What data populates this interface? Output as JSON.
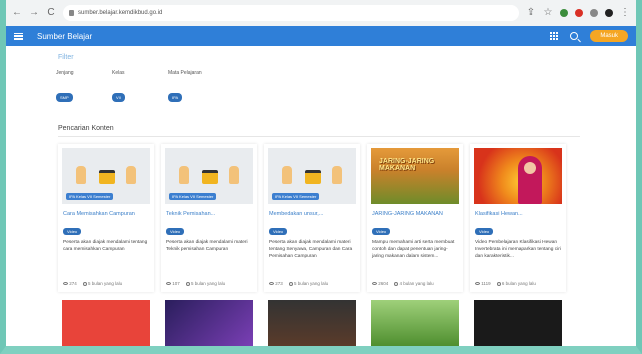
{
  "browser": {
    "url": "sumber.belajar.kemdikbud.go.id",
    "nav": [
      "←",
      "→",
      "C"
    ]
  },
  "header": {
    "title": "Sumber Belajar",
    "login_label": "Masuk",
    "colors": {
      "bar": "#2f7fd8",
      "login": "#f5a623"
    }
  },
  "filter": {
    "title": "Filter",
    "groups": [
      {
        "label": "Jenjang",
        "value": "SMP"
      },
      {
        "label": "Kelas",
        "value": "VII"
      },
      {
        "label": "Mata Pelajaran",
        "value": "IPA"
      }
    ]
  },
  "content": {
    "section_title": "Pencarian Konten",
    "badge": "Video",
    "cards": [
      {
        "title": "Cara Memisahkan Campuran",
        "thumb_tag": "IPA Kelas VII Semester",
        "desc": "Peserta akan diajak mendalami tentang cara memisahkan Campuran",
        "views": "274",
        "time": "5 bulan yang lalu"
      },
      {
        "title": "Teknik Pemisahan...",
        "thumb_tag": "IPA Kelas VII Semester",
        "desc": "Peserta akan diajak mendalami materi Teknik pemisahan Campuran",
        "views": "107",
        "time": "5 bulan yang lalu"
      },
      {
        "title": "Membedakan unsur,...",
        "thumb_tag": "IPA Kelas VII Semester",
        "desc": "Peserta akan diajak mendalami materi tentang Senyawa, Campuran dan Cara Pemisahan Campuran",
        "views": "273",
        "time": "5 bulan yang lalu"
      },
      {
        "title": "JARING-JARING MAKANAN",
        "thumb_title": "JARING-JARING MAKANAN",
        "desc": "Mampu memahami arti serta membuat contoh dan dapat penentuan jaring-jaring makanan dalam sistem...",
        "views": "2604",
        "time": "4 bulan yang lalu"
      },
      {
        "title": "Klasifikasi Hewan...",
        "desc": "Video Pembelajaran Klasifikasi Hewan Invertebrata ini memaparkan tentang ciri dan karakteristik...",
        "views": "1119",
        "time": "6 bulan yang lalu"
      }
    ]
  }
}
